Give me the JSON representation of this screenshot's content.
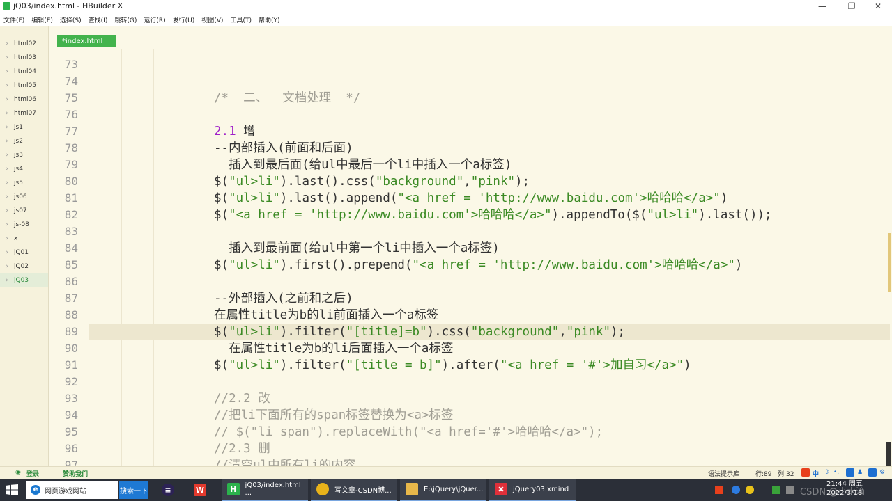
{
  "window": {
    "title": "jQ03/index.html - HBuilder X",
    "controls": [
      "—",
      "❐",
      "✕"
    ]
  },
  "menu": [
    "文件(F)",
    "编辑(E)",
    "选择(S)",
    "查找(I)",
    "跳转(G)",
    "运行(R)",
    "发行(U)",
    "视图(V)",
    "工具(T)",
    "帮助(Y)"
  ],
  "sidebar": {
    "items": [
      "html02",
      "html03",
      "html04",
      "html05",
      "html06",
      "html07",
      "js1",
      "js2",
      "js3",
      "js4",
      "js5",
      "js06",
      "js07",
      "js-08",
      "x",
      "jQ01",
      "jQ02",
      "jQ03"
    ],
    "active": "jQ03"
  },
  "tab": {
    "label": "*index.html"
  },
  "editor": {
    "current_line": "89",
    "lines": [
      {
        "n": "73",
        "segs": []
      },
      {
        "n": "74",
        "segs": []
      },
      {
        "n": "75",
        "segs": [
          {
            "t": "/*  二、  文档处理  */",
            "c": "comment"
          }
        ]
      },
      {
        "n": "76",
        "segs": []
      },
      {
        "n": "77",
        "segs": [
          {
            "t": "2.1",
            "c": "num"
          },
          {
            "t": " 增",
            "c": "plain"
          }
        ]
      },
      {
        "n": "78",
        "segs": [
          {
            "t": "--内部插入(前面和后面)",
            "c": "plain"
          }
        ]
      },
      {
        "n": "79",
        "segs": [
          {
            "t": "  插入到最后面(给ul中最后一个li中插入一个a标签)",
            "c": "plain"
          }
        ]
      },
      {
        "n": "80",
        "segs": [
          {
            "t": "$(",
            "c": "plain"
          },
          {
            "t": "\"ul>li\"",
            "c": "str"
          },
          {
            "t": ").last().css(",
            "c": "plain"
          },
          {
            "t": "\"background\"",
            "c": "str"
          },
          {
            "t": ",",
            "c": "plain"
          },
          {
            "t": "\"pink\"",
            "c": "str"
          },
          {
            "t": ");",
            "c": "plain"
          }
        ]
      },
      {
        "n": "81",
        "segs": [
          {
            "t": "$(",
            "c": "plain"
          },
          {
            "t": "\"ul>li\"",
            "c": "str"
          },
          {
            "t": ").last().append(",
            "c": "plain"
          },
          {
            "t": "\"<a href = 'http://www.baidu.com'>哈哈哈</a>\"",
            "c": "str"
          },
          {
            "t": ")",
            "c": "plain"
          }
        ]
      },
      {
        "n": "82",
        "segs": [
          {
            "t": "$(",
            "c": "plain"
          },
          {
            "t": "\"<a href = 'http://www.baidu.com'>哈哈哈</a>\"",
            "c": "str"
          },
          {
            "t": ").appendTo($(",
            "c": "plain"
          },
          {
            "t": "\"ul>li\"",
            "c": "str"
          },
          {
            "t": ").last());",
            "c": "plain"
          }
        ]
      },
      {
        "n": "83",
        "segs": []
      },
      {
        "n": "84",
        "segs": [
          {
            "t": "  插入到最前面(给ul中第一个li中插入一个a标签)",
            "c": "plain"
          }
        ]
      },
      {
        "n": "85",
        "segs": [
          {
            "t": "$(",
            "c": "plain"
          },
          {
            "t": "\"ul>li\"",
            "c": "str"
          },
          {
            "t": ").first().prepend(",
            "c": "plain"
          },
          {
            "t": "\"<a href = 'http://www.baidu.com'>哈哈哈</a>\"",
            "c": "str"
          },
          {
            "t": ")",
            "c": "plain"
          }
        ]
      },
      {
        "n": "86",
        "segs": []
      },
      {
        "n": "87",
        "segs": [
          {
            "t": "--外部插入(之前和之后)",
            "c": "plain"
          }
        ]
      },
      {
        "n": "88",
        "segs": [
          {
            "t": "在属性title为b的li前面插入一个a标签",
            "c": "plain"
          }
        ]
      },
      {
        "n": "89",
        "segs": [
          {
            "t": "$(",
            "c": "plain"
          },
          {
            "t": "\"ul>li\"",
            "c": "str"
          },
          {
            "t": ").filter(",
            "c": "plain"
          },
          {
            "t": "\"[title]=b\"",
            "c": "str"
          },
          {
            "t": ").css(",
            "c": "plain"
          },
          {
            "t": "\"background\"",
            "c": "str"
          },
          {
            "t": ",",
            "c": "plain"
          },
          {
            "t": "\"pink\"",
            "c": "str"
          },
          {
            "t": ");",
            "c": "plain"
          }
        ]
      },
      {
        "n": "90",
        "segs": [
          {
            "t": "  在属性title为b的li后面插入一个a标签",
            "c": "plain"
          }
        ]
      },
      {
        "n": "91",
        "segs": [
          {
            "t": "$(",
            "c": "plain"
          },
          {
            "t": "\"ul>li\"",
            "c": "str"
          },
          {
            "t": ").filter(",
            "c": "plain"
          },
          {
            "t": "\"[title = b]\"",
            "c": "str"
          },
          {
            "t": ").after(",
            "c": "plain"
          },
          {
            "t": "\"<a href = '#'>加自习</a>\"",
            "c": "str"
          },
          {
            "t": ")",
            "c": "plain"
          }
        ]
      },
      {
        "n": "92",
        "segs": []
      },
      {
        "n": "93",
        "segs": [
          {
            "t": "//2.2 改",
            "c": "comment"
          }
        ]
      },
      {
        "n": "94",
        "segs": [
          {
            "t": "//把li下面所有的span标签替换为<a>标签",
            "c": "comment"
          }
        ]
      },
      {
        "n": "95",
        "segs": [
          {
            "t": "// $(\"li span\").replaceWith(\"<a href='#'>哈哈哈</a>\");",
            "c": "comment"
          }
        ]
      },
      {
        "n": "96",
        "segs": [
          {
            "t": "//2.3 删",
            "c": "comment"
          }
        ]
      },
      {
        "n": "97",
        "segs": [
          {
            "t": "//清空ul中所有li的内容",
            "c": "comment"
          }
        ]
      }
    ]
  },
  "status": {
    "login": "登录",
    "sponsor": "赞助我们",
    "syntax_hint": "语法提示库",
    "row": "行:89",
    "col": "列:32"
  },
  "taskbar": {
    "search_value": "网页游戏网站",
    "search_button": "搜索一下",
    "apps": [
      {
        "label": "jQ03/index.html ...",
        "icon": "H",
        "color": "#2bb24c"
      },
      {
        "label": "写文章-CSDN博...",
        "icon": "●",
        "color": "#e8b21a"
      },
      {
        "label": "E:\\jQuery\\jQuer...",
        "icon": "▮",
        "color": "#e8b84a"
      },
      {
        "label": "jQuery03.xmind",
        "icon": "✖",
        "color": "#e0303a"
      }
    ],
    "clock_time": "21:44 周五",
    "clock_date": "2022/3/18",
    "watermark": "CSDN @小水滴"
  }
}
